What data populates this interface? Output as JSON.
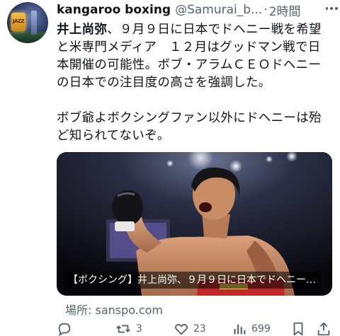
{
  "tweet": {
    "author_name": "kangaroo boxing",
    "author_handle": "@Samurai_b...",
    "separator": "·",
    "time": "2時間",
    "avatar_sign_text": "JAZZ",
    "text_lines": [
      "井上尚弥、９月９日に日本でドヘニー戦を希望",
      "と米専門メディア　１２月はグッドマン戦で日",
      "本開催の可能性。ボブ・アラムＣＥＯドヘニー",
      "の日本での注目度の高さを強調した。",
      "",
      "ボブ爺よボクシングファン以外にドヘニーは殆",
      "ど知られてないぞ。"
    ],
    "card": {
      "caption": "【ボクシング】井上尚弥、９月９日に日本でドヘニー…",
      "source_label": "場所: sanspo.com"
    },
    "actions": {
      "reply": {
        "icon": "reply-icon",
        "count": ""
      },
      "retweet": {
        "icon": "retweet-icon",
        "count": "3"
      },
      "like": {
        "icon": "heart-icon",
        "count": "23"
      },
      "views": {
        "icon": "views-icon",
        "count": "699"
      },
      "bookmark": {
        "icon": "bookmark-icon",
        "count": ""
      },
      "share": {
        "icon": "share-icon",
        "count": ""
      }
    },
    "colors": {
      "text": "#0f1419",
      "secondary": "#536471"
    }
  }
}
